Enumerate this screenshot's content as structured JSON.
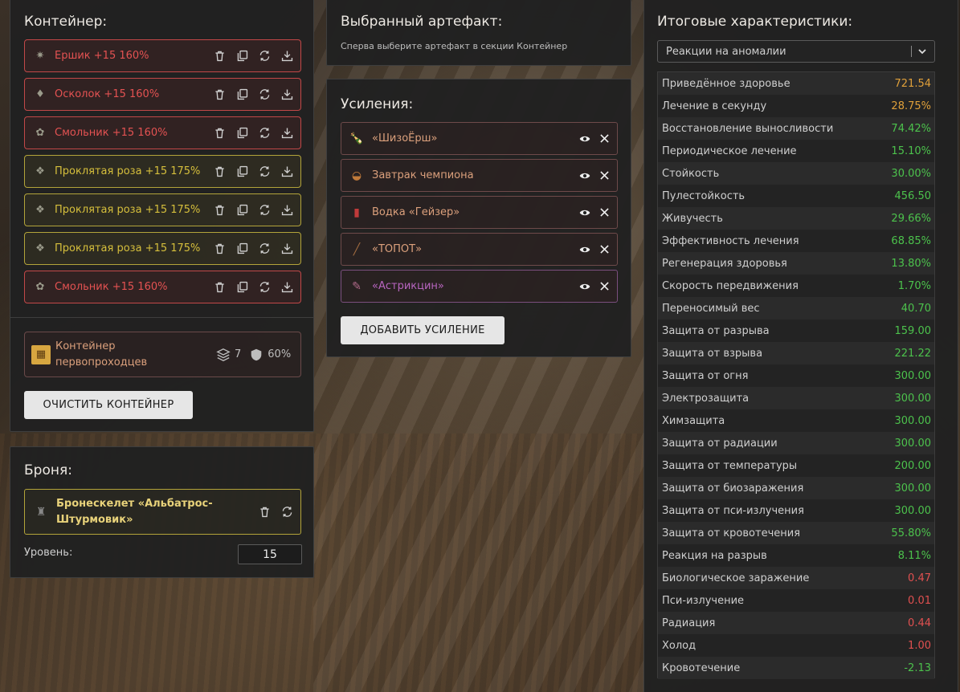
{
  "container": {
    "title": "Контейнер:",
    "artifacts": [
      {
        "label": "Ершик +15 160%",
        "color": "red",
        "icon": "ershik-icon"
      },
      {
        "label": "Осколок +15 160%",
        "color": "red",
        "icon": "oskolok-icon"
      },
      {
        "label": "Смольник +15 160%",
        "color": "red",
        "icon": "smolnik-icon"
      },
      {
        "label": "Проклятая роза +15 175%",
        "color": "yellow",
        "icon": "rose-icon"
      },
      {
        "label": "Проклятая роза +15 175%",
        "color": "yellow",
        "icon": "rose-icon"
      },
      {
        "label": "Проклятая роза +15 175%",
        "color": "yellow",
        "icon": "rose-icon"
      },
      {
        "label": "Смольник +15 160%",
        "color": "red",
        "icon": "smolnik-icon"
      }
    ],
    "container_item": {
      "name": "Контейнер первопроходцев",
      "slots": "7",
      "protection": "60%"
    },
    "clear_button": "ОЧИСТИТЬ КОНТЕЙНЕР"
  },
  "armor": {
    "title": "Броня:",
    "item": "Бронескелет «Альбатрос-Штурмовик»",
    "level_label": "Уровень:",
    "level_value": "15"
  },
  "selected": {
    "title": "Выбранный артефакт:",
    "hint": "Сперва выберите артефакт в секции Контейнер"
  },
  "boosts": {
    "title": "Усиления:",
    "items": [
      {
        "label": "«ШизоЁрш»",
        "icon": "bottle-icon"
      },
      {
        "label": "Завтрак чемпиона",
        "icon": "food-icon"
      },
      {
        "label": "Водка «Гейзер»",
        "icon": "vodka-icon"
      },
      {
        "label": "«ТОПОТ»",
        "icon": "stick-icon"
      },
      {
        "label": "«Астрикцин»",
        "icon": "syringe-icon",
        "color": "purple"
      }
    ],
    "add_button": "ДОБАВИТЬ УСИЛЕНИЕ"
  },
  "totals": {
    "title": "Итоговые характеристики:",
    "filter": "Реакции на аномалии",
    "stats": [
      {
        "name": "Приведённое здоровье",
        "value": "721.54",
        "color": "#e0a03a"
      },
      {
        "name": "Лечение в секунду",
        "value": "28.75%",
        "color": "#e0a03a"
      },
      {
        "name": "Восстановление выносливости",
        "value": "74.42%",
        "color": "#4cc24c"
      },
      {
        "name": "Периодическое лечение",
        "value": "15.10%",
        "color": "#4cc24c"
      },
      {
        "name": "Стойкость",
        "value": "30.00%",
        "color": "#4cc24c"
      },
      {
        "name": "Пулестойкость",
        "value": "456.50",
        "color": "#4cc24c"
      },
      {
        "name": "Живучесть",
        "value": "29.66%",
        "color": "#4cc24c"
      },
      {
        "name": "Эффективность лечения",
        "value": "68.85%",
        "color": "#4cc24c"
      },
      {
        "name": "Регенерация здоровья",
        "value": "13.80%",
        "color": "#4cc24c"
      },
      {
        "name": "Скорость передвижения",
        "value": "1.70%",
        "color": "#4cc24c"
      },
      {
        "name": "Переносимый вес",
        "value": "40.70",
        "color": "#4cc24c"
      },
      {
        "name": "Защита от разрыва",
        "value": "159.00",
        "color": "#4cc24c"
      },
      {
        "name": "Защита от взрыва",
        "value": "221.22",
        "color": "#4cc24c"
      },
      {
        "name": "Защита от огня",
        "value": "300.00",
        "color": "#4cc24c"
      },
      {
        "name": "Электрозащита",
        "value": "300.00",
        "color": "#4cc24c"
      },
      {
        "name": "Химзащита",
        "value": "300.00",
        "color": "#4cc24c"
      },
      {
        "name": "Защита от радиации",
        "value": "300.00",
        "color": "#4cc24c"
      },
      {
        "name": "Защита от температуры",
        "value": "200.00",
        "color": "#4cc24c"
      },
      {
        "name": "Защита от биозаражения",
        "value": "300.00",
        "color": "#4cc24c"
      },
      {
        "name": "Защита от пси-излучения",
        "value": "300.00",
        "color": "#4cc24c"
      },
      {
        "name": "Защита от кровотечения",
        "value": "55.80%",
        "color": "#4cc24c"
      },
      {
        "name": "Реакция на разрыв",
        "value": "8.11%",
        "color": "#4cc24c"
      },
      {
        "name": "Биологическое заражение",
        "value": "0.47",
        "color": "#e05050"
      },
      {
        "name": "Пси-излучение",
        "value": "0.01",
        "color": "#e05050"
      },
      {
        "name": "Радиация",
        "value": "0.44",
        "color": "#e05050"
      },
      {
        "name": "Холод",
        "value": "1.00",
        "color": "#e05050"
      },
      {
        "name": "Кровотечение",
        "value": "-2.13",
        "color": "#4cc24c"
      }
    ]
  }
}
